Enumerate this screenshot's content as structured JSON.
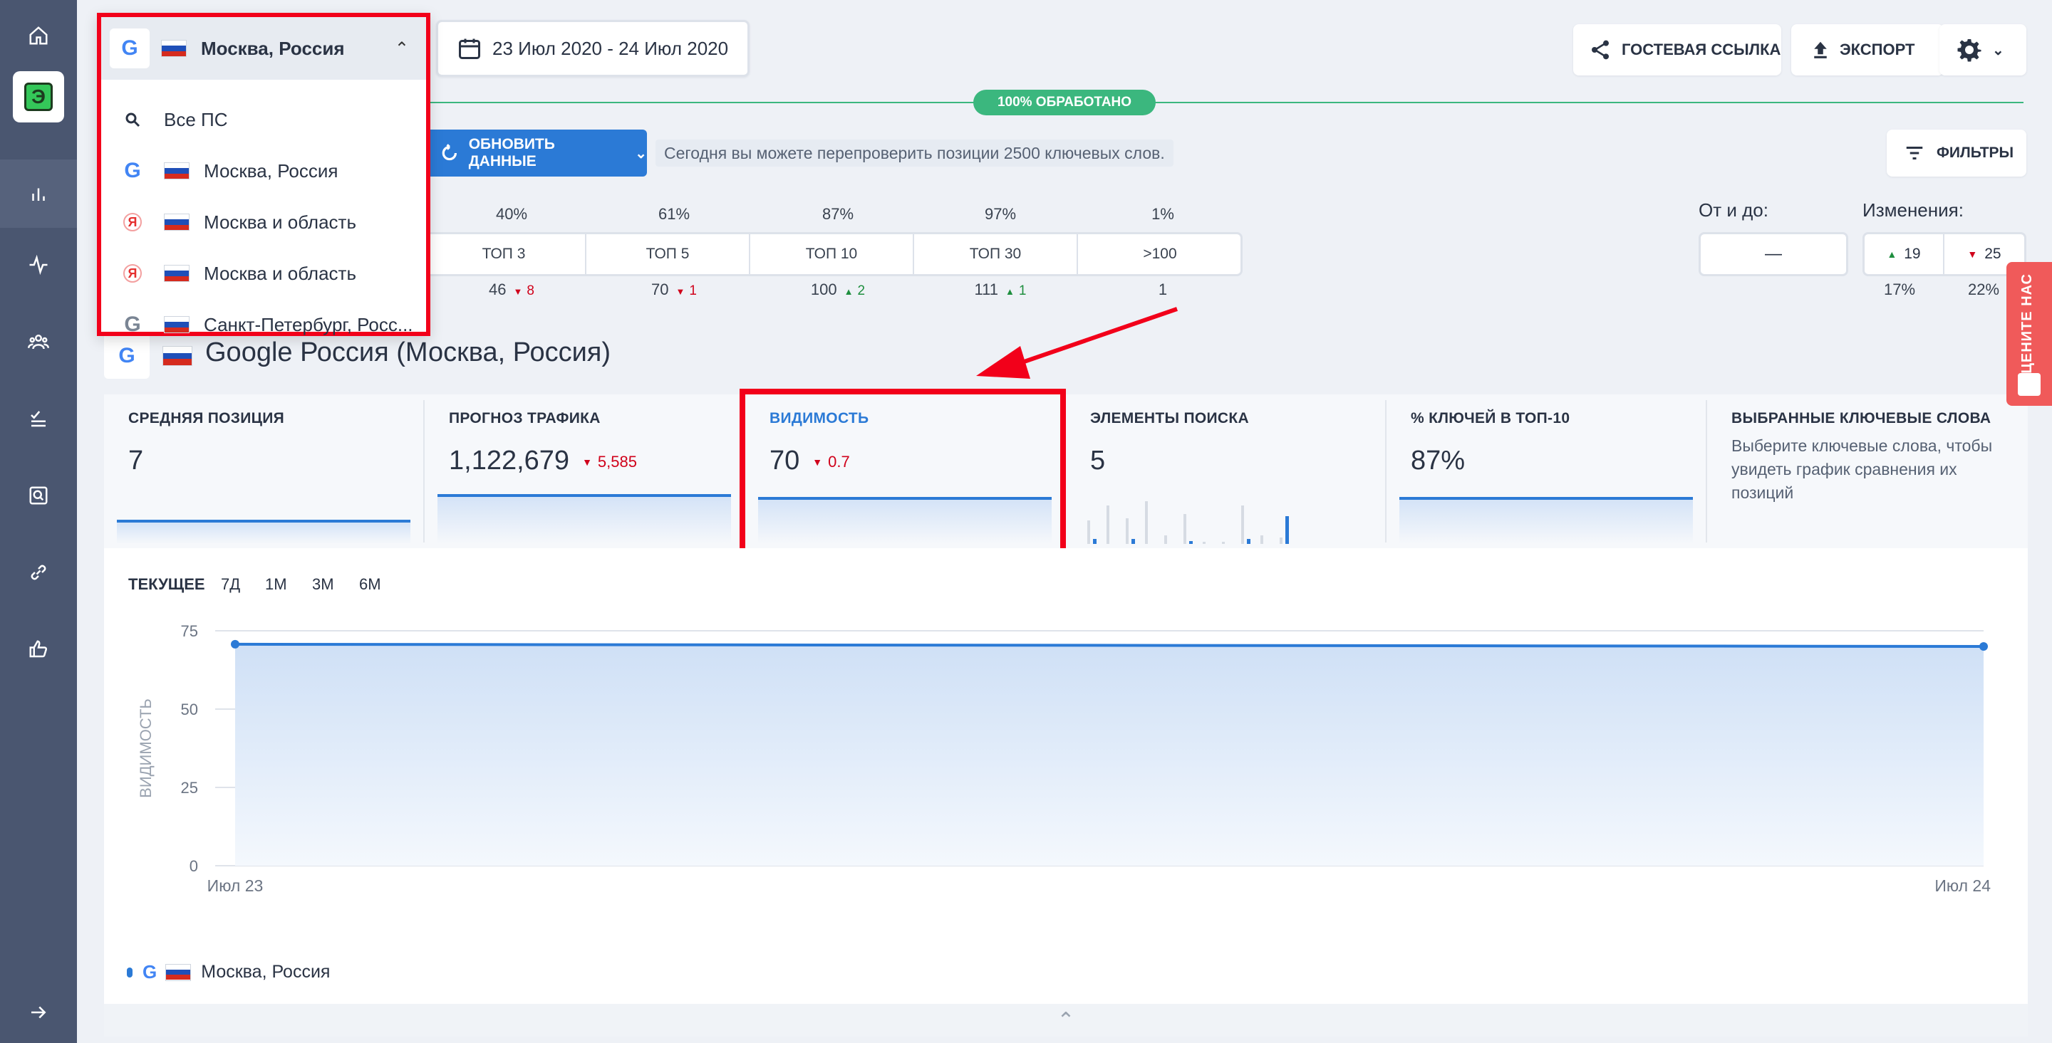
{
  "sidebar": {
    "icons": [
      "home-icon",
      "logo-icon",
      "analytics-icon",
      "pulse-icon",
      "users-icon",
      "checklist-icon",
      "search-doc-icon",
      "link-icon",
      "like-icon",
      "arrow-right-icon"
    ]
  },
  "header": {
    "date_range": "23 Июл 2020 - 24 Июл 2020",
    "guest_link": "ГОСТЕВАЯ ССЫЛКА",
    "export": "ЭКСПОРТ",
    "progress": "100% ОБРАБОТАНО",
    "progress_value": 100
  },
  "dropdown": {
    "selected": "Москва, Россия",
    "items": [
      {
        "engine": "search-icon",
        "label": "Все ПС"
      },
      {
        "engine": "google",
        "label": "Москва, Россия"
      },
      {
        "engine": "yandex",
        "label": "Москва и область"
      },
      {
        "engine": "yandex",
        "label": "Москва и область"
      },
      {
        "engine": "google-gray",
        "label": "Санкт-Петербург, Росс..."
      }
    ]
  },
  "toolbar": {
    "update_button": "ОБНОВИТЬ ДАННЫЕ",
    "update_note": "Сегодня вы можете перепроверить позиции 2500 ключевых слов.",
    "filters": "ФИЛЬТРЫ"
  },
  "position_stats": [
    {
      "percent": "40%",
      "label": "ТОП 3",
      "count": "46",
      "delta": "8",
      "dir": "down"
    },
    {
      "percent": "61%",
      "label": "ТОП 5",
      "count": "70",
      "delta": "1",
      "dir": "down"
    },
    {
      "percent": "87%",
      "label": "ТОП 10",
      "count": "100",
      "delta": "2",
      "dir": "up"
    },
    {
      "percent": "97%",
      "label": "ТОП 30",
      "count": "111",
      "delta": "1",
      "dir": "up"
    },
    {
      "percent": "1%",
      "label": ">100",
      "count": "1",
      "delta": "",
      "dir": ""
    }
  ],
  "range_filter": {
    "title": "От и до:",
    "separator": "—"
  },
  "changes": {
    "title": "Изменения:",
    "up": "19",
    "down": "25",
    "up_pct": "17%",
    "down_pct": "22%"
  },
  "engine_title": "Google Россия (Москва, Россия)",
  "cards": [
    {
      "title": "СРЕДНЯЯ ПОЗИЦИЯ",
      "value": "7",
      "delta": ""
    },
    {
      "title": "ПРОГНОЗ ТРАФИКА",
      "value": "1,122,679",
      "delta": "5,585"
    },
    {
      "title": "ВИДИМОСТЬ",
      "value": "70",
      "delta": "0.7"
    },
    {
      "title": "ЭЛЕМЕНТЫ ПОИСКА",
      "value": "5",
      "delta": ""
    },
    {
      "title": "% КЛЮЧЕЙ В ТОП-10",
      "value": "87%",
      "delta": ""
    },
    {
      "title": "ВЫБРАННЫЕ КЛЮЧЕВЫЕ СЛОВА",
      "value": "",
      "note": "Выберите ключевые слова, чтобы увидеть график сравнения их позиций"
    }
  ],
  "search_elements_bars": [
    {
      "gray": 0.55,
      "blue": 0.12
    },
    {
      "gray": 0.9,
      "blue": 0
    },
    {
      "gray": 0.6,
      "blue": 0.12
    },
    {
      "gray": 1.0,
      "blue": 0
    },
    {
      "gray": 0.2,
      "blue": 0
    },
    {
      "gray": 0.7,
      "blue": 0.06
    },
    {
      "gray": 0.05,
      "blue": 0
    },
    {
      "gray": 0.05,
      "blue": 0
    },
    {
      "gray": 0.9,
      "blue": 0.12
    },
    {
      "gray": 0.2,
      "blue": 0
    },
    {
      "gray": 0.15,
      "blue": 0.65
    }
  ],
  "chart_tabs": [
    "ТЕКУЩЕЕ",
    "7Д",
    "1М",
    "3М",
    "6М"
  ],
  "chart_data": {
    "type": "area",
    "x": [
      "Июл 23",
      "Июл 24"
    ],
    "series": [
      {
        "name": "Москва, Россия",
        "values": [
          70.7,
          70
        ]
      }
    ],
    "ylabel": "ВИДИМОСТЬ",
    "ylim": [
      0,
      75
    ],
    "yticks": [
      0,
      25,
      50,
      75
    ],
    "grid": true
  },
  "legend_label": "Москва, Россия",
  "rate_us": "ОЦЕНИТЕ НАС",
  "colors": {
    "accent": "#2b7ad6",
    "highlight": "#f2001a",
    "progress": "#3bb77e"
  }
}
